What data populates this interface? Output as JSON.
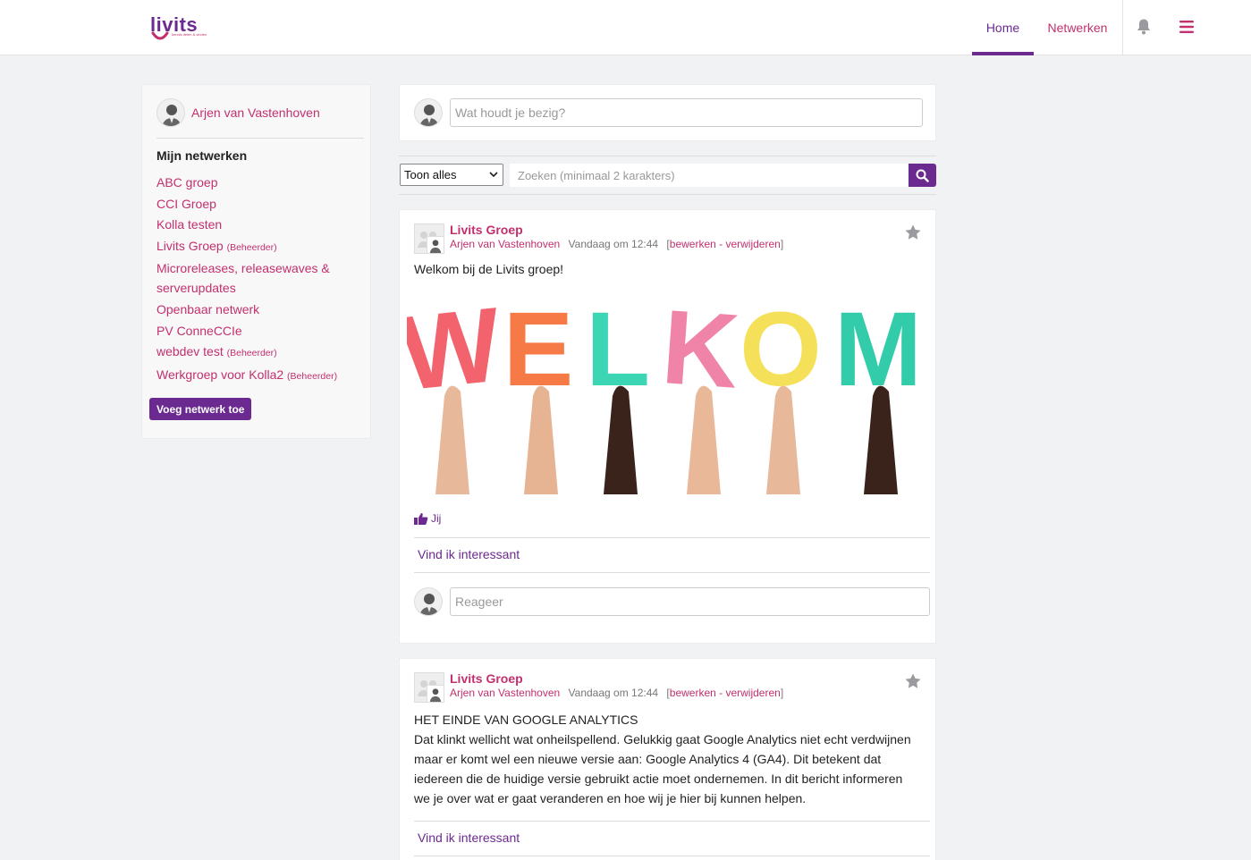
{
  "header": {
    "logo_text": "livits",
    "logo_tagline": "kennis delen & vinden",
    "nav": {
      "home": "Home",
      "networks": "Netwerken"
    },
    "icons": [
      "bell-icon",
      "hamburger-menu-icon"
    ],
    "accent_color": "#6b2a8f",
    "link_color": "#c2306e"
  },
  "sidebar": {
    "user_name": "Arjen van Vastenhoven",
    "heading": "Mijn netwerken",
    "networks": [
      {
        "name": "ABC groep",
        "badge": ""
      },
      {
        "name": "CCI Groep",
        "badge": ""
      },
      {
        "name": "Kolla testen",
        "badge": ""
      },
      {
        "name": "Livits Groep",
        "badge": "(Beheerder)"
      },
      {
        "name": "Microreleases, releasewaves & serverupdates",
        "badge": ""
      },
      {
        "name": "Openbaar netwerk",
        "badge": ""
      },
      {
        "name": "PV ConneCCIe",
        "badge": ""
      },
      {
        "name": "webdev test",
        "badge": "(Beheerder)"
      },
      {
        "name": "Werkgroep voor Kolla2",
        "badge": "(Beheerder)"
      }
    ],
    "add_button": "Voeg netwerk toe"
  },
  "composer": {
    "placeholder": "Wat houdt je bezig?"
  },
  "filter": {
    "select_value": "Toon alles",
    "search_placeholder": "Zoeken (minimaal 2 karakters)"
  },
  "posts": [
    {
      "group": "Livits Groep",
      "author": "Arjen van Vastenhoven",
      "time": "Vandaag om 12:44",
      "edit": "bewerken",
      "separator": " - ",
      "delete": "verwijderen",
      "text": "Welkom bij de Livits groep!",
      "image_word": "WELKOM",
      "letter_colors": [
        "#f2636d",
        "#f57a45",
        "#3dd6b4",
        "#ef84a8",
        "#f5e05a",
        "#33ccaa"
      ],
      "likes": "Jij",
      "like_action": "Vind ik interessant",
      "reply_placeholder": "Reageer"
    },
    {
      "group": "Livits Groep",
      "author": "Arjen van Vastenhoven",
      "time": "Vandaag om 12:44",
      "edit": "bewerken",
      "separator": " - ",
      "delete": "verwijderen",
      "title": "HET EINDE VAN GOOGLE ANALYTICS",
      "lines": [
        "Dat klinkt wellicht wat onheilspellend. Gelukkig gaat Google Analytics niet echt verdwijnen",
        "maar er komt wel een nieuwe versie aan: Google Analytics 4 (GA4). Dit betekent dat",
        "iedereen die de huidige versie gebruikt actie moet ondernemen. In dit bericht informeren",
        "we je over wat er gaat veranderen en hoe wij je hier bij kunnen helpen."
      ],
      "like_action": "Vind ik interessant"
    }
  ]
}
